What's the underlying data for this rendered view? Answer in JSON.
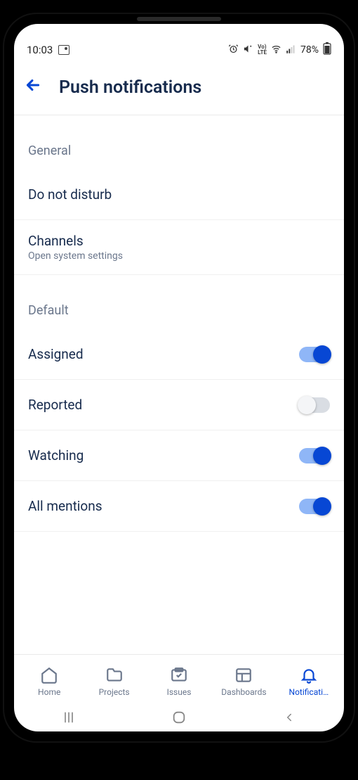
{
  "status": {
    "time": "10:03",
    "battery": "78%"
  },
  "header": {
    "title": "Push notifications"
  },
  "sections": {
    "general": {
      "label": "General",
      "dnd": "Do not disturb",
      "channels": "Channels",
      "channels_sub": "Open system settings"
    },
    "default": {
      "label": "Default",
      "assigned": {
        "label": "Assigned",
        "on": true
      },
      "reported": {
        "label": "Reported",
        "on": false
      },
      "watching": {
        "label": "Watching",
        "on": true
      },
      "mentions": {
        "label": "All mentions",
        "on": true
      }
    }
  },
  "nav": {
    "home": "Home",
    "projects": "Projects",
    "issues": "Issues",
    "dashboards": "Dashboards",
    "notifications": "Notificati…"
  }
}
